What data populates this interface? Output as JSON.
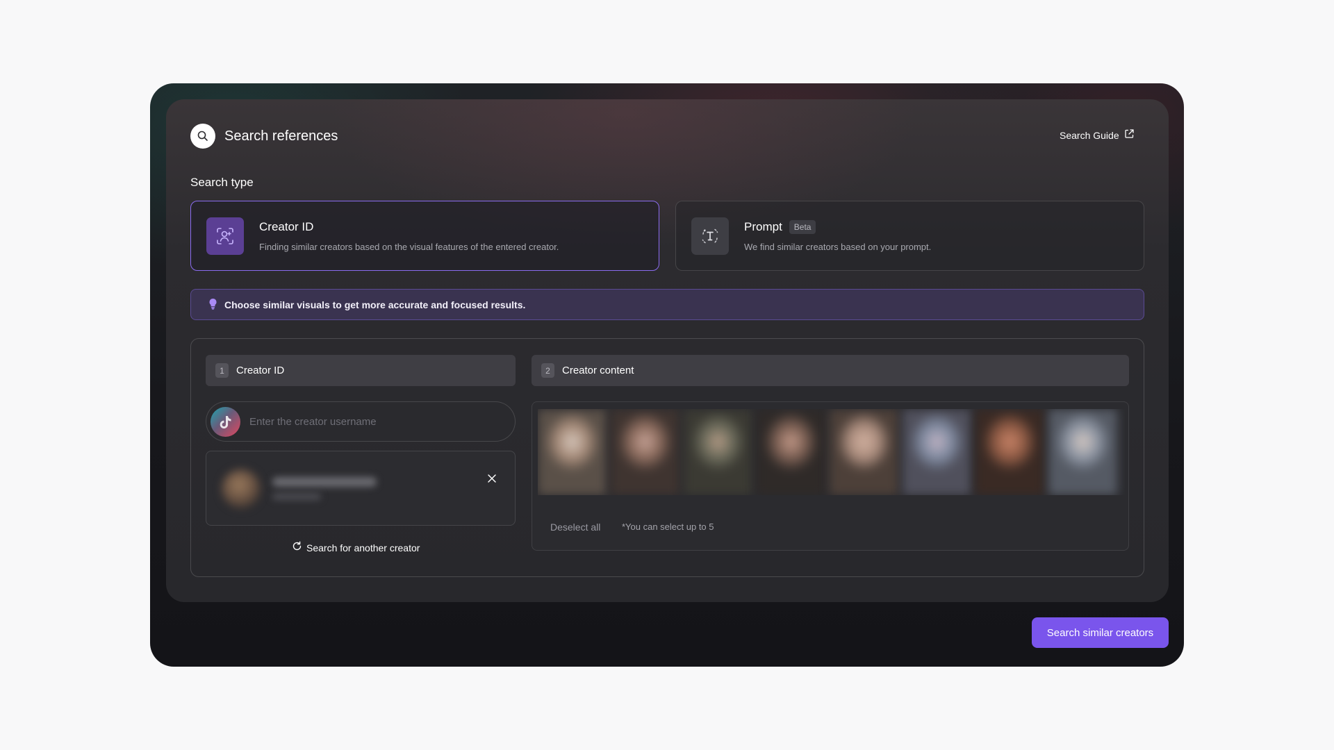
{
  "header": {
    "title": "Search references",
    "guide_label": "Search Guide",
    "icons": {
      "search": "search-icon",
      "external": "external-link-icon"
    }
  },
  "search_type": {
    "label": "Search type",
    "options": [
      {
        "title": "Creator ID",
        "description": "Finding similar creators based on the visual features of the entered creator.",
        "selected": true,
        "icon": "face-scan-icon"
      },
      {
        "title": "Prompt",
        "badge": "Beta",
        "description": "We find similar creators based on your prompt.",
        "selected": false,
        "icon": "text-cursor-icon"
      }
    ]
  },
  "tip": {
    "text": "Choose similar visuals to get more accurate and focused results.",
    "icon": "lightbulb-icon"
  },
  "steps": [
    {
      "number": "1",
      "label": "Creator ID"
    },
    {
      "number": "2",
      "label": "Creator content"
    }
  ],
  "creator_input": {
    "placeholder": "Enter the creator username",
    "value": "",
    "platform_icon": "tiktok-icon"
  },
  "selected_creator": {
    "close_icon": "close-icon"
  },
  "refresh_label": "Search for another creator",
  "content": {
    "deselect_label": "Deselect all",
    "limit_note": "*You can select up to 5",
    "thumbnails": [
      {
        "colors": [
          "#a58a78",
          "#d7c8bd",
          "#5a5048"
        ]
      },
      {
        "colors": [
          "#8a6a5c",
          "#c7a397",
          "#3f3430"
        ]
      },
      {
        "colors": [
          "#6a6a5a",
          "#b59b86",
          "#3b3a33"
        ]
      },
      {
        "colors": [
          "#7a5e52",
          "#c49a89",
          "#2f2a28"
        ]
      },
      {
        "colors": [
          "#a98b7c",
          "#d3b2a1",
          "#4d4039"
        ]
      },
      {
        "colors": [
          "#7f8aa0",
          "#c2b4c4",
          "#50505c"
        ]
      },
      {
        "colors": [
          "#8e5a44",
          "#c98468",
          "#3a2a24"
        ]
      },
      {
        "colors": [
          "#8e96a4",
          "#d6c9c2",
          "#555a64"
        ]
      }
    ]
  },
  "cta_label": "Search similar creators",
  "colors": {
    "accent": "#7a55ec",
    "selected_border": "#8b6cf0",
    "tip_bg": "#3a3350"
  }
}
